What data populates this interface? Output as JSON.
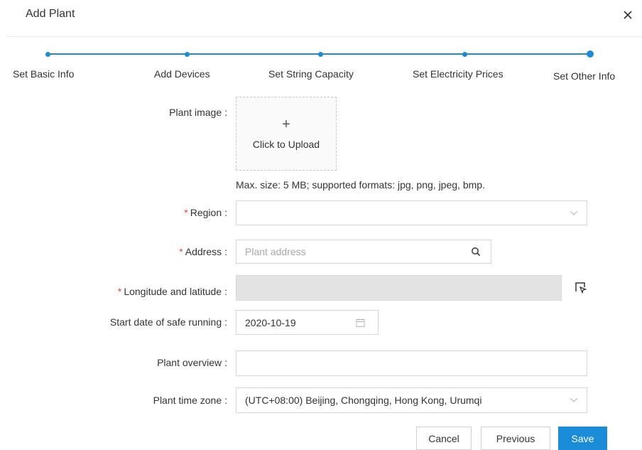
{
  "dialog": {
    "title": "Add Plant"
  },
  "steps": [
    {
      "label": "Set Basic Info"
    },
    {
      "label": "Add Devices"
    },
    {
      "label": "Set String Capacity"
    },
    {
      "label": "Set Electricity Prices"
    },
    {
      "label": "Set Other Info",
      "active": true
    }
  ],
  "form": {
    "plant_image": {
      "label": "Plant image",
      "upload_plus": "+",
      "upload_text": "Click to Upload",
      "hint": "Max. size: 5 MB; supported formats: jpg, png, jpeg, bmp."
    },
    "region": {
      "label": "Region",
      "required": "*",
      "value": ""
    },
    "address": {
      "label": "Address",
      "required": "*",
      "placeholder": "Plant address"
    },
    "lnglat": {
      "label": "Longitude and latitude",
      "required": "*",
      "value": ""
    },
    "start_date": {
      "label": "Start date of safe running",
      "value": "2020-10-19"
    },
    "overview": {
      "label": "Plant overview",
      "value": ""
    },
    "time_zone": {
      "label": "Plant time zone",
      "value": "(UTC+08:00) Beijing, Chongqing, Hong Kong, Urumqi"
    },
    "colon": ":"
  },
  "buttons": {
    "cancel": "Cancel",
    "previous": "Previous",
    "save": "Save"
  },
  "colors": {
    "accent": "#1a8cd8",
    "required": "#e8413c",
    "disabled_bg": "#e3e3e3"
  },
  "icons": {
    "close": "close-icon",
    "chevron": "chevron-down-icon",
    "search": "search-icon",
    "map_pick": "map-pick-icon",
    "calendar": "calendar-icon"
  }
}
